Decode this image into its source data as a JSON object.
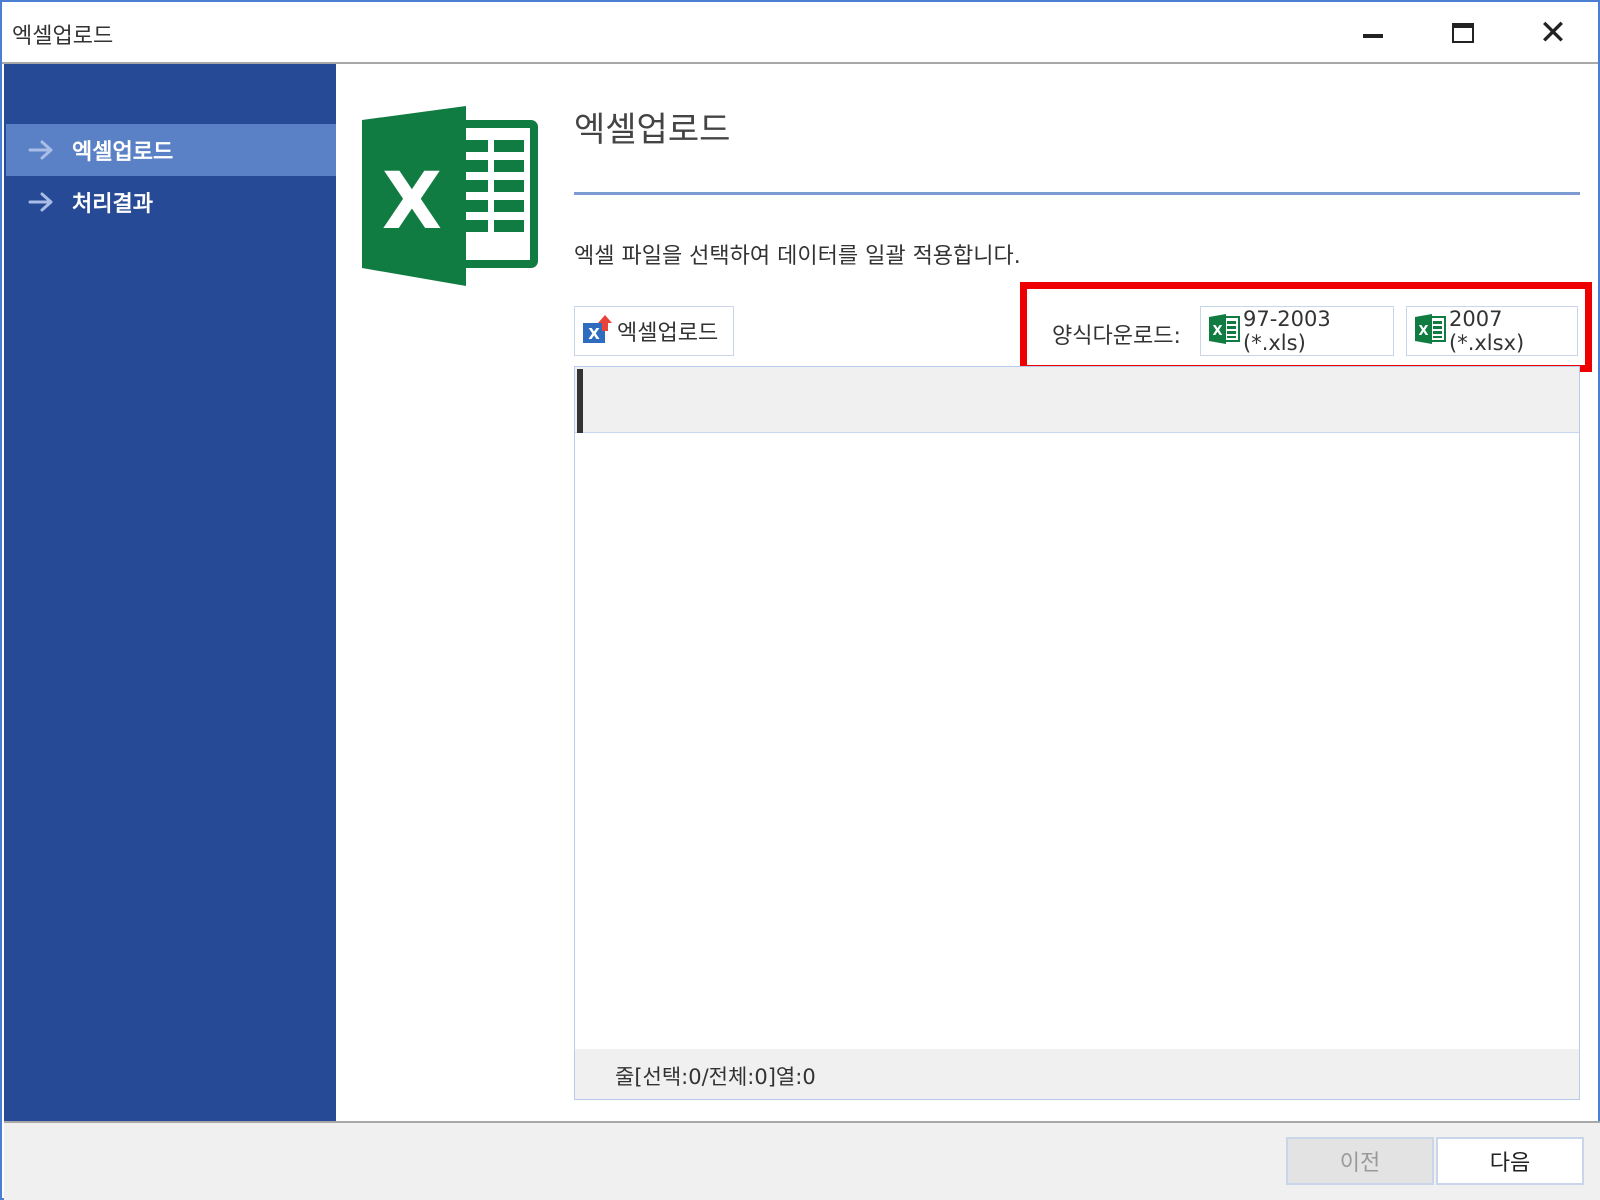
{
  "window": {
    "title": "엑셀업로드",
    "controls": {
      "minimize": "minimize",
      "maximize": "maximize",
      "close": "close"
    }
  },
  "sidebar": {
    "items": [
      {
        "label": "엑셀업로드",
        "active": true,
        "icon": "arrow-right-icon"
      },
      {
        "label": "처리결과",
        "active": false,
        "icon": "arrow-right-icon"
      }
    ]
  },
  "main": {
    "logo_icon": "excel-logo-icon",
    "title": "엑셀업로드",
    "description": "엑셀 파일을 선택하여 데이터를 일괄 적용합니다.",
    "upload_button": {
      "label": "엑셀업로드",
      "icon": "excel-upload-icon"
    },
    "template": {
      "label": "양식다운로드:",
      "buttons": [
        {
          "label": "97-2003 (*.xls)",
          "icon": "excel-icon"
        },
        {
          "label": "2007 (*.xlsx)",
          "icon": "excel-icon"
        }
      ]
    },
    "grid": {
      "status": "줄[선택:0/전체:0]열:0"
    }
  },
  "footer": {
    "prev_label": "이전",
    "next_label": "다음",
    "prev_enabled": false
  },
  "colors": {
    "sidebar_bg": "#264a96",
    "sidebar_active": "#5a80c6",
    "excel_green": "#107c41",
    "highlight_red": "#ee0000",
    "rule_blue": "#7d9bd3"
  }
}
